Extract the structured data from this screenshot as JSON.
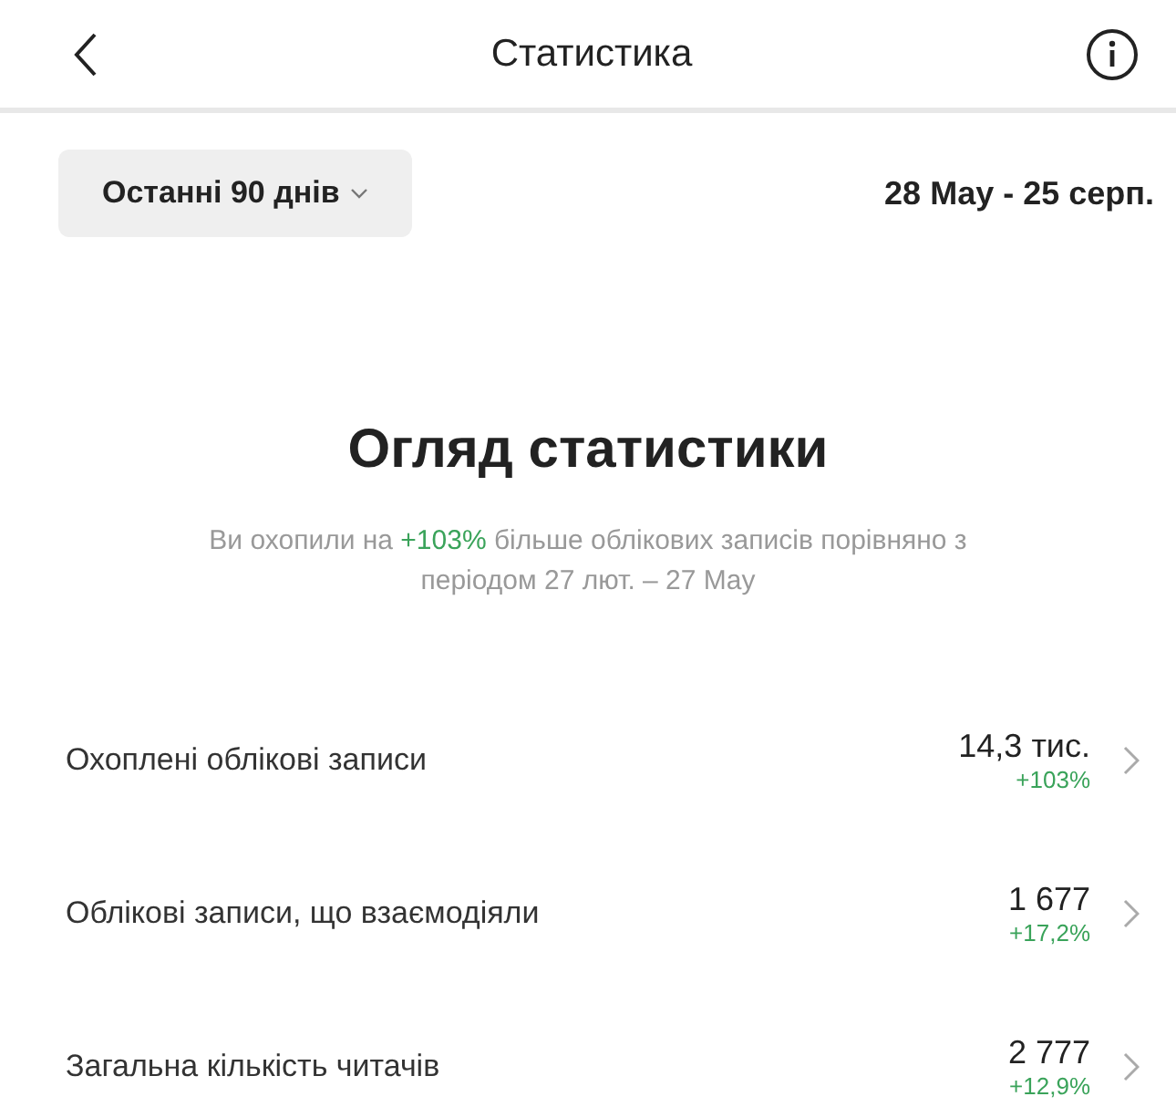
{
  "header": {
    "title": "Статистика"
  },
  "filter": {
    "period": "Останні 90 днів",
    "range": "28 May - 25 серп."
  },
  "overview": {
    "title": "Огляд статистики",
    "summary_before": "Ви охопили на ",
    "summary_highlight": "+103%",
    "summary_after": " більше облікових записів порівняно з періодом 27 лют. – 27 May"
  },
  "metrics": [
    {
      "label": "Охоплені облікові записи",
      "value": "14,3 тис.",
      "change": "+103%"
    },
    {
      "label": "Облікові записи, що взаємодіяли",
      "value": "1 677",
      "change": "+17,2%"
    },
    {
      "label": "Загальна кількість читачів",
      "value": "2 777",
      "change": "+12,9%"
    }
  ]
}
